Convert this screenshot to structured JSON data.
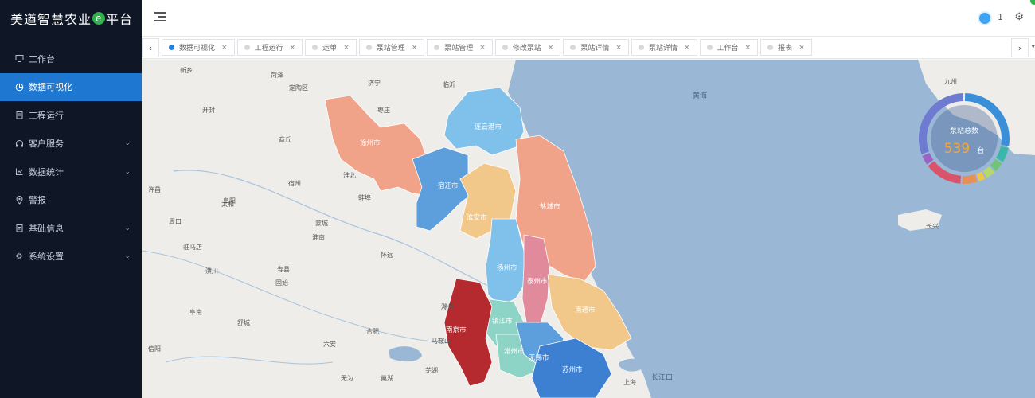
{
  "brand": {
    "title_part1": "美遒智慧农业",
    "title_mark": "e",
    "title_part2": "平台"
  },
  "sidebar": {
    "items": [
      {
        "label": "工作台",
        "icon": "desktop-icon",
        "active": false,
        "expandable": false
      },
      {
        "label": "数据可视化",
        "icon": "chart-circle-icon",
        "active": true,
        "expandable": false
      },
      {
        "label": "工程运行",
        "icon": "clipboard-icon",
        "active": false,
        "expandable": false
      },
      {
        "label": "客户服务",
        "icon": "headset-icon",
        "active": false,
        "expandable": true
      },
      {
        "label": "数据统计",
        "icon": "line-chart-icon",
        "active": false,
        "expandable": true
      },
      {
        "label": "警报",
        "icon": "location-icon",
        "active": false,
        "expandable": false
      },
      {
        "label": "基础信息",
        "icon": "document-icon",
        "active": false,
        "expandable": true
      },
      {
        "label": "系统设置",
        "icon": "gear-icon",
        "active": false,
        "expandable": true
      }
    ]
  },
  "header": {
    "user_count": "1"
  },
  "tabs": [
    {
      "label": "数据可视化",
      "active": true
    },
    {
      "label": "工程运行",
      "active": false
    },
    {
      "label": "运单",
      "active": false
    },
    {
      "label": "泵站管理",
      "active": false
    },
    {
      "label": "泵站管理",
      "active": false
    },
    {
      "label": "修改泵站",
      "active": false
    },
    {
      "label": "泵站详情",
      "active": false
    },
    {
      "label": "泵站详情",
      "active": false
    },
    {
      "label": "工作台",
      "active": false
    },
    {
      "label": "报表",
      "active": false
    }
  ],
  "map": {
    "sea_labels": [
      "黄海",
      "长江口"
    ],
    "place_labels": [
      "新乡",
      "菏泽",
      "定陶区",
      "济宁",
      "临沂",
      "枣庄",
      "开封",
      "商丘",
      "宿州",
      "淮北",
      "蚌埠",
      "阜阳",
      "淮南",
      "六安",
      "合肥",
      "芜湖",
      "马鞍山",
      "滁州",
      "阜南",
      "许昌",
      "周口",
      "驻马店",
      "信阳",
      "太和",
      "蒙城",
      "怀远",
      "巢湖",
      "舒城",
      "无为",
      "上海",
      "九州",
      "长兴",
      "寿县",
      "潢川",
      "固始"
    ],
    "city_labels": [
      "徐州市",
      "连云港市",
      "宿迁市",
      "淮安市",
      "盐城市",
      "扬州市",
      "泰州市",
      "南通市",
      "镇江市",
      "常州市",
      "南京市",
      "无锡市",
      "苏州市"
    ]
  },
  "widget": {
    "label": "泵站总数",
    "value": "539",
    "unit": "台"
  },
  "colors": {
    "sidebar_bg": "#0f1727",
    "accent": "#1e78d2",
    "donut_segments": [
      "#3b8fd9",
      "#3bb7a9",
      "#6fc476",
      "#b5d96a",
      "#f2c744",
      "#e88f57",
      "#d9536b",
      "#9a63c4",
      "#6f7ad1"
    ]
  }
}
